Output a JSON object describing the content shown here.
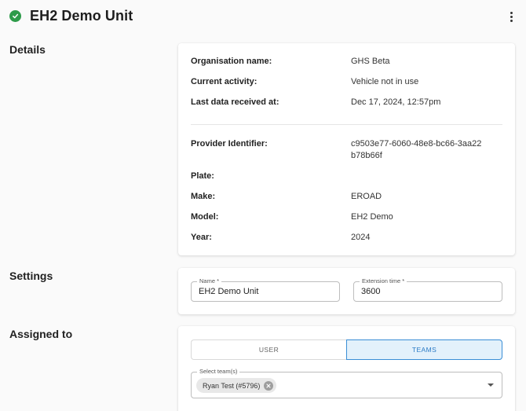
{
  "header": {
    "title": "EH2 Demo Unit",
    "status_icon": "check-circle-icon",
    "status_color": "#2e9b4a",
    "more_icon": "more-vertical-icon"
  },
  "details": {
    "heading": "Details",
    "rows_top": [
      {
        "label": "Organisation name:",
        "value": "GHS Beta"
      },
      {
        "label": "Current activity:",
        "value": "Vehicle not in use"
      },
      {
        "label": "Last data received at:",
        "value": "Dec 17, 2024, 12:57pm"
      }
    ],
    "rows_bottom": [
      {
        "label": "Provider Identifier:",
        "value": "c9503e77-6060-48e8-bc66-3aa22b78b66f"
      },
      {
        "label": "Plate:",
        "value": ""
      },
      {
        "label": "Make:",
        "value": "EROAD"
      },
      {
        "label": "Model:",
        "value": "EH2 Demo"
      },
      {
        "label": "Year:",
        "value": "2024"
      }
    ]
  },
  "settings": {
    "heading": "Settings",
    "name_label": "Name *",
    "name_value": "EH2 Demo Unit",
    "extension_label": "Extension time *",
    "extension_value": "3600"
  },
  "assigned": {
    "heading": "Assigned to",
    "toggle_user": "USER",
    "toggle_teams": "TEAMS",
    "selected_toggle": "TEAMS",
    "accent_color": "#3a8ed6",
    "select_label": "Select team(s)",
    "chips": [
      "Ryan Test (#5796)"
    ]
  }
}
